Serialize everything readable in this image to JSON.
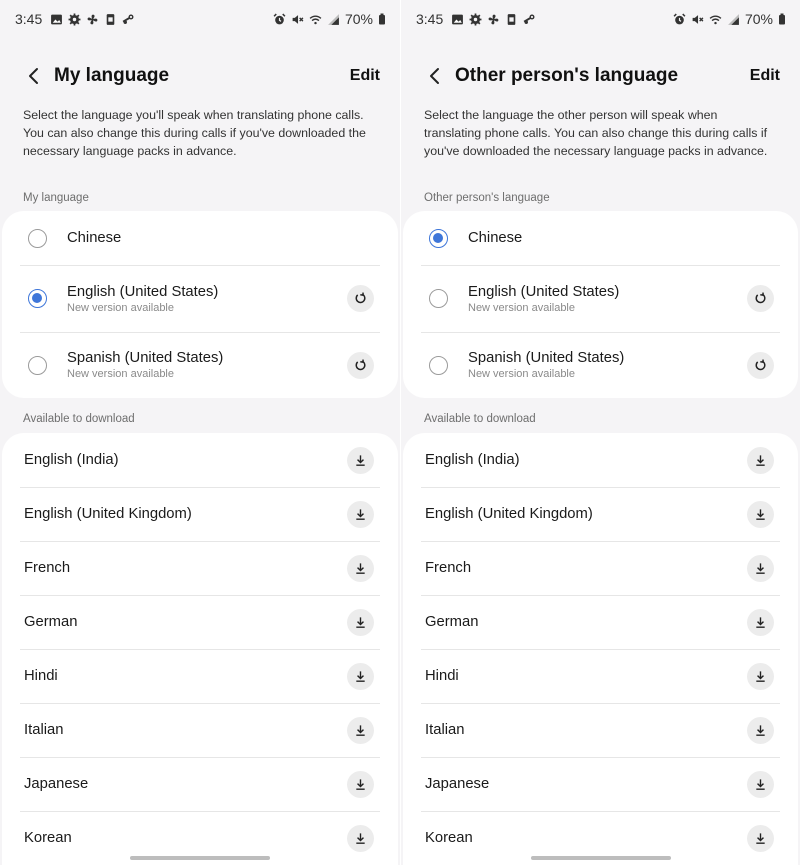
{
  "status_bar": {
    "time": "3:45",
    "battery": "70%",
    "left_icons": [
      "gallery-icon",
      "settings-gear-icon",
      "fan-icon",
      "sim-icon",
      "steam-icon"
    ],
    "right_icons": [
      "alarm-icon",
      "mute-icon",
      "wifi-icon",
      "signal-icon",
      "battery-icon"
    ]
  },
  "screens": [
    {
      "title": "My language",
      "edit_label": "Edit",
      "description": "Select the language you'll speak when translating phone calls. You can also change this during calls if you've downloaded the necessary language packs in advance.",
      "installed_section_label": "My language",
      "installed": [
        {
          "name": "Chinese",
          "sub": "",
          "selected": false,
          "update": false
        },
        {
          "name": "English (United States)",
          "sub": "New version available",
          "selected": true,
          "update": true
        },
        {
          "name": "Spanish (United States)",
          "sub": "New version available",
          "selected": false,
          "update": true
        }
      ],
      "download_section_label": "Available to download",
      "downloads": [
        "English (India)",
        "English (United Kingdom)",
        "French",
        "German",
        "Hindi",
        "Italian",
        "Japanese",
        "Korean"
      ]
    },
    {
      "title": "Other person's language",
      "edit_label": "Edit",
      "description": "Select the language the other person will speak when translating phone calls. You can also change this during calls if you've downloaded the necessary language packs in advance.",
      "installed_section_label": "Other person's language",
      "installed": [
        {
          "name": "Chinese",
          "sub": "",
          "selected": true,
          "update": false
        },
        {
          "name": "English (United States)",
          "sub": "New version available",
          "selected": false,
          "update": true
        },
        {
          "name": "Spanish (United States)",
          "sub": "New version available",
          "selected": false,
          "update": true
        }
      ],
      "download_section_label": "Available to download",
      "downloads": [
        "English (India)",
        "English (United Kingdom)",
        "French",
        "German",
        "Hindi",
        "Italian",
        "Japanese",
        "Korean"
      ]
    }
  ],
  "colors": {
    "accent": "#3e76d9",
    "background": "#f5f4f6",
    "card": "#ffffff"
  }
}
